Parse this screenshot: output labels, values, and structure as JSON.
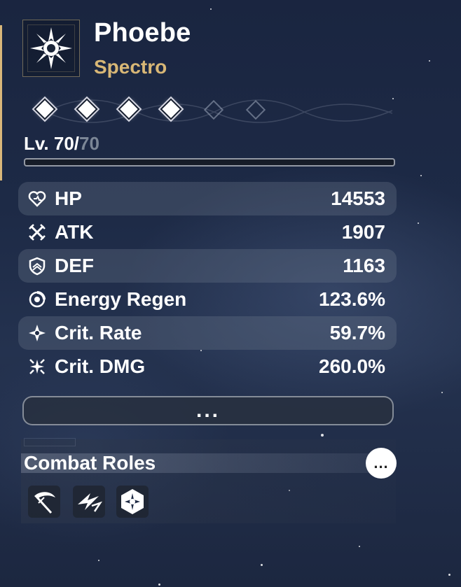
{
  "character": {
    "name": "Phoebe",
    "element": "Spectro",
    "portrait_icon": "spectro-sun-icon"
  },
  "resonance_nodes": {
    "total": 6,
    "unlocked": 4
  },
  "level": {
    "prefix": "Lv. ",
    "current": "70",
    "separator": "/",
    "max": "70",
    "exp_progress": 0
  },
  "stats": [
    {
      "icon": "heart-icon",
      "label": "HP",
      "value": "14553"
    },
    {
      "icon": "swords-icon",
      "label": "ATK",
      "value": "1907"
    },
    {
      "icon": "shield-icon",
      "label": "DEF",
      "value": "1163"
    },
    {
      "icon": "energy-regen-icon",
      "label": "Energy Regen",
      "value": "123.6%"
    },
    {
      "icon": "crit-rate-icon",
      "label": "Crit. Rate",
      "value": "59.7%"
    },
    {
      "icon": "crit-dmg-icon",
      "label": "Crit. DMG",
      "value": "260.0%"
    }
  ],
  "more_button_label": "...",
  "combat_roles": {
    "title": "Combat Roles",
    "more_label": "...",
    "roles": [
      {
        "icon": "scythe-icon"
      },
      {
        "icon": "lightning-icon"
      },
      {
        "icon": "spectro-hex-icon"
      }
    ]
  },
  "colors": {
    "accent_gold": "#d8b776",
    "stat_band": "#6e788c",
    "level_max": "#7b8696"
  }
}
